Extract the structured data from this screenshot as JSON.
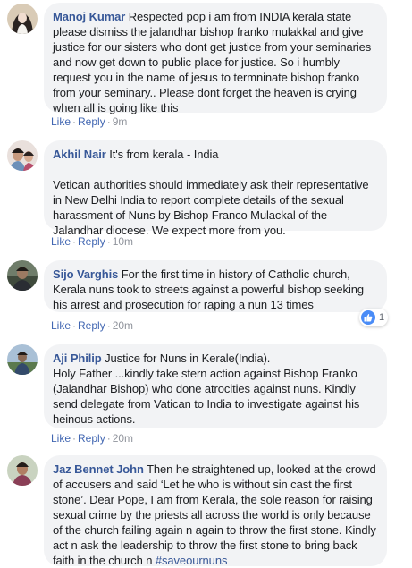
{
  "comments": [
    {
      "name": "Manoj Kumar",
      "paragraphs": [
        "Respected pop i am from INDIA kerala state please dismiss the jalandhar bishop franko mulakkal and give justice for our sisters who dont get justice from your seminaries and now get down to public place for justice. So i humbly request you in the name of jesus to termninate bishop franko from your seminary.. Please dont forget the heaven is crying when all is going like this"
      ],
      "like": "Like",
      "reply": "Reply",
      "time": "9m"
    },
    {
      "name": "Akhil Nair",
      "paragraphs": [
        "It's from kerala - India",
        "Vetican authorities should immediately ask their representative in New Delhi India to report complete details of the sexual harassment of Nuns by Bishop Franco Mulackal of the Jalandhar diocese. We expect more from you."
      ],
      "like": "Like",
      "reply": "Reply",
      "time": "10m"
    },
    {
      "name": "Sijo Varghis",
      "paragraphs": [
        "For the first time in history of Catholic church, Kerala nuns took to streets against a powerful bishop seeking his arrest and prosecution for raping a nun 13 times"
      ],
      "like": "Like",
      "reply": "Reply",
      "time": "20m",
      "reaction_count": "1"
    },
    {
      "name": "Aji Philip",
      "paragraphs": [
        "Justice for Nuns in Kerale(India).",
        "Holy Father ...kindly take stern action against Bishop Franko (Jalandhar Bishop) who done atrocities against nuns. Kindly send delegate from Vatican to India to investigate against his heinous actions."
      ],
      "like": "Like",
      "reply": "Reply",
      "time": "20m"
    },
    {
      "name": "Jaz Bennet John",
      "paragraphs": [
        "Then he straightened up, looked at the crowd of accusers and said ‘Let he who is without sin cast the first stone’. Dear Pope, I am from Kerala, the sole reason for raising sexual crime by the priests all across the world is only because of the church failing again n again to throw the first stone. Kindly act n ask the leadership to throw the first stone to bring back faith in the church n"
      ],
      "hashtag": "#saveournuns"
    }
  ],
  "separator": "·",
  "colors": {
    "name_link": "#385898",
    "action_link": "#4267b2",
    "bubble": "#f2f3f5",
    "meta": "#90949c",
    "like_badge": "#4a8cf7"
  },
  "icons": {
    "reaction": "like-icon"
  }
}
